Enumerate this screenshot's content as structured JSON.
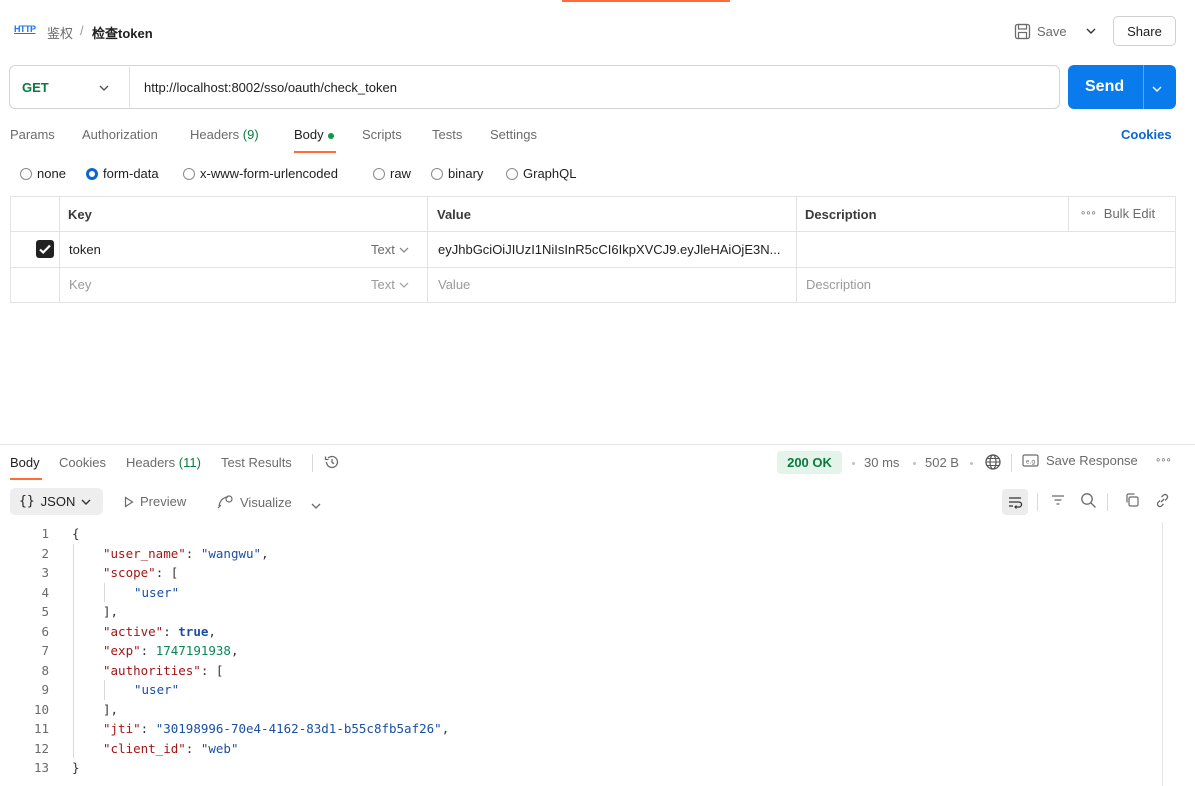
{
  "header": {
    "protocol_badge": "HTTP",
    "breadcrumb_parent": "鉴权",
    "breadcrumb_separator": "/",
    "breadcrumb_current": "检查token",
    "save_label": "Save",
    "share_label": "Share"
  },
  "request": {
    "method": "GET",
    "url": "http://localhost:8002/sso/oauth/check_token",
    "send_label": "Send"
  },
  "request_tabs": {
    "params": "Params",
    "authorization": "Authorization",
    "headers": "Headers",
    "headers_count": "(9)",
    "body": "Body",
    "scripts": "Scripts",
    "tests": "Tests",
    "settings": "Settings",
    "cookies": "Cookies"
  },
  "body_types": {
    "none": "none",
    "form_data": "form-data",
    "urlencoded": "x-www-form-urlencoded",
    "raw": "raw",
    "binary": "binary",
    "graphql": "GraphQL",
    "selected": "form-data"
  },
  "form_table": {
    "headers": {
      "key": "Key",
      "value": "Value",
      "description": "Description",
      "bulk_edit": "Bulk Edit"
    },
    "rows": [
      {
        "checked": true,
        "key": "token",
        "type": "Text",
        "value": "eyJhbGciOiJIUzI1NiIsInR5cCI6IkpXVCJ9.eyJleHAiOjE3N...",
        "description": ""
      }
    ],
    "placeholder": {
      "key": "Key",
      "type": "Text",
      "value": "Value",
      "description": "Description"
    }
  },
  "response": {
    "tabs": {
      "body": "Body",
      "cookies": "Cookies",
      "headers": "Headers",
      "headers_count": "(11)",
      "test_results": "Test Results"
    },
    "status": "200 OK",
    "time": "30 ms",
    "size": "502 B",
    "save_response": "Save Response",
    "format": "JSON",
    "preview": "Preview",
    "visualize": "Visualize"
  },
  "colors": {
    "accent": "#ff6c37",
    "send_button": "#097bed",
    "status_ok": "#0b7a3e",
    "link": "#0a66d1"
  },
  "json_lines": [
    {
      "n": "1",
      "i": 0,
      "t": "{"
    },
    {
      "n": "2",
      "i": 1,
      "k": "\"user_name\"",
      "s": "\"wangwu\"",
      "p": ","
    },
    {
      "n": "3",
      "i": 1,
      "k": "\"scope\"",
      "p": "["
    },
    {
      "n": "4",
      "i": 2,
      "s": "\"user\""
    },
    {
      "n": "5",
      "i": 1,
      "t": "],"
    },
    {
      "n": "6",
      "i": 1,
      "k": "\"active\"",
      "b": "true",
      "p": ","
    },
    {
      "n": "7",
      "i": 1,
      "k": "\"exp\"",
      "num": "1747191938",
      "p": ","
    },
    {
      "n": "8",
      "i": 1,
      "k": "\"authorities\"",
      "p": "["
    },
    {
      "n": "9",
      "i": 2,
      "s": "\"user\""
    },
    {
      "n": "10",
      "i": 1,
      "t": "],"
    },
    {
      "n": "11",
      "i": 1,
      "k": "\"jti\"",
      "s": "\"30198996-70e4-4162-83d1-b55c8fb5af26\"",
      "p": ","
    },
    {
      "n": "12",
      "i": 1,
      "k": "\"client_id\"",
      "s": "\"web\""
    },
    {
      "n": "13",
      "i": 0,
      "t": "}"
    }
  ]
}
